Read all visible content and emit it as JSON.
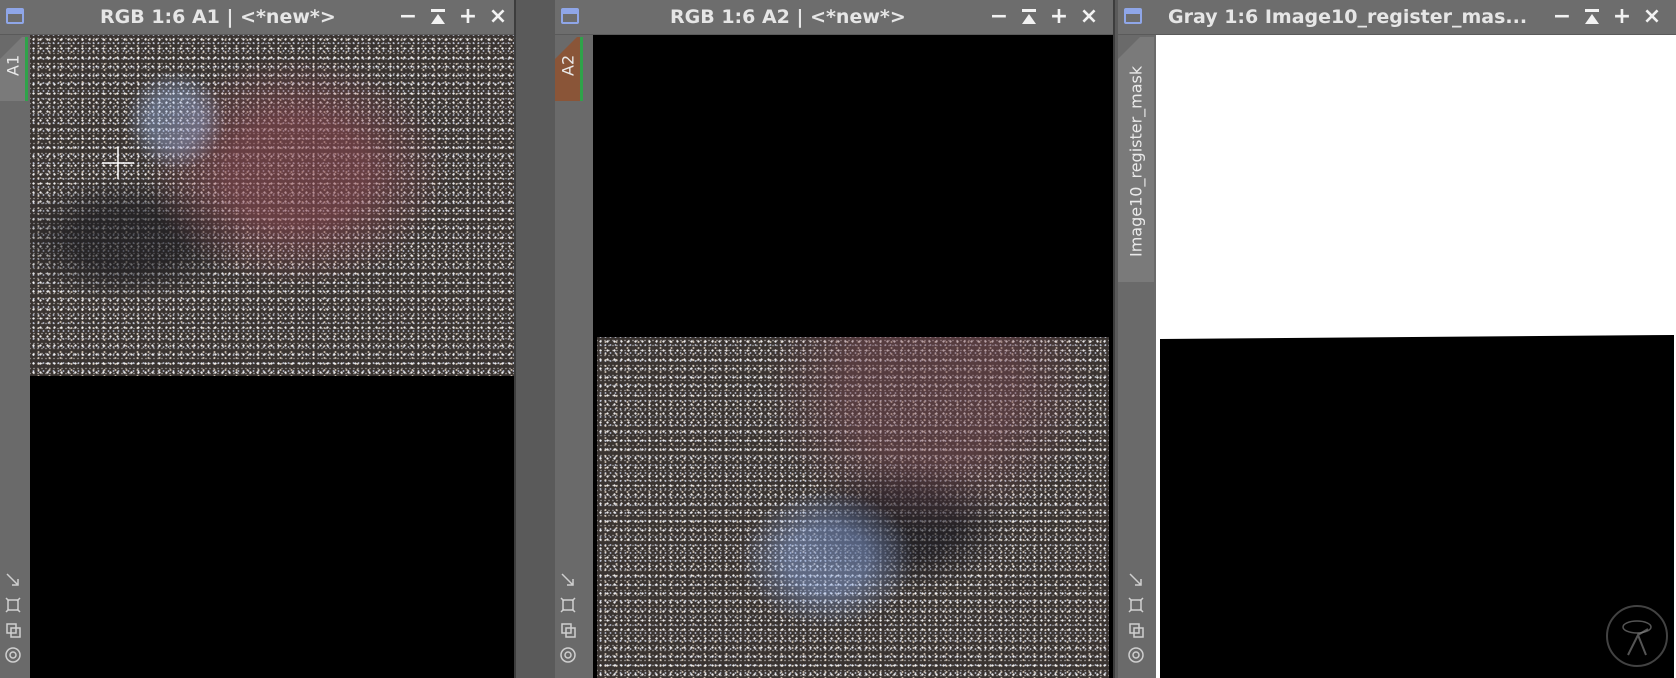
{
  "windows": [
    {
      "title": "RGB 1:6 A1 | <*new*>",
      "tab_label": "A1",
      "tab_color": "#7a7a7a",
      "tab_accent": "#2fa34a"
    },
    {
      "title": "RGB 1:6 A2 | <*new*>",
      "tab_label": "A2",
      "tab_color": "#8a5538",
      "tab_accent": "#2fa34a"
    },
    {
      "title": "Gray 1:6 Image10_register_mas...",
      "tab_label": "Image10_register_mask",
      "tab_color": "#7a7a7a"
    }
  ],
  "controls": {
    "minimize": "−",
    "shade": "shade-icon",
    "maximize": "+",
    "close": "×"
  },
  "colors": {
    "title_text": "#e6e6e6",
    "window_icon": "#8fa6e8",
    "frame": "#6a6a6a"
  }
}
